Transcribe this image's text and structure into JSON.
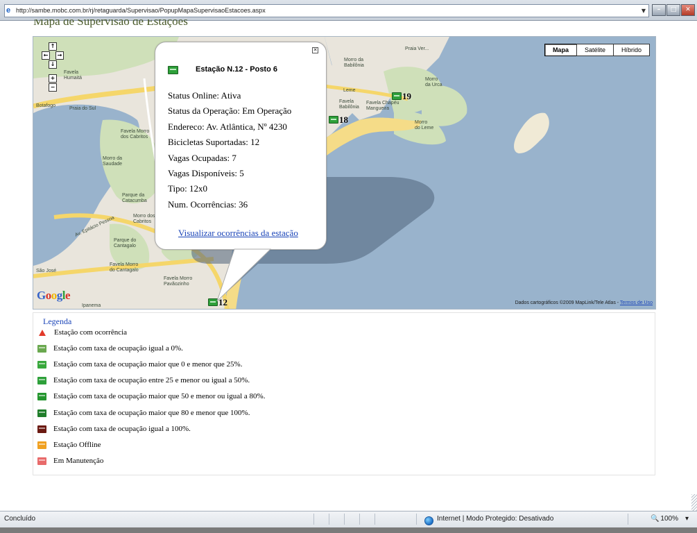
{
  "browser": {
    "url": "http://sambe.mobc.com.br/rj/retaguarda/Supervisao/PopupMapaSupervisaoEstacoes.aspx",
    "controls": {
      "minimize": "–",
      "maximize": "□",
      "close": "✕"
    }
  },
  "page": {
    "heading": "Mapa de Supervisão de Estações"
  },
  "map": {
    "types": [
      "Mapa",
      "Satélite",
      "Híbrido"
    ],
    "active_type": "Mapa",
    "labels": {
      "favela_humaita": "Favela\nHumaitá",
      "rio_sul": "Praia do Sul",
      "favela_morro": "Favela Morro\ndos Cabritos",
      "morro_saudade": "Morro da\nSaudade",
      "parque_catacumba": "Parque da\nCatacumba",
      "morro_cabritos": "Morro dos\nCabritos",
      "parque_cantagalo": "Parque do\nCantagalo",
      "favela_cantagalo": "Favela Morro\ndo Cantagalo",
      "favela_pavaozinho": "Favela Morro\nPavãozinho",
      "morro_babilonia": "Morro da\nBabilônia",
      "leme": "Leme",
      "favela_babilonia": "Favela\nBabilônia",
      "favela_chapeu": "Favela Chapéu\nMangueira",
      "morro_leme": "Morro\ndo Leme",
      "morro_urca": "Morro\nda Urca",
      "praia_vermelha": "Praia Ver...",
      "av_epitacio": "Av. Epitácio Pessoa",
      "botafogo": "Botafogo",
      "sao_jose": "São José",
      "ipanema": "Ipanema"
    },
    "markers": [
      {
        "num": "19",
        "color": "#2ea03a"
      },
      {
        "num": "18",
        "color": "#2ea03a"
      },
      {
        "num": "12",
        "color": "#2ea03a"
      }
    ],
    "logo": [
      "G",
      "o",
      "o",
      "g",
      "l",
      "e"
    ],
    "copyright": "Dados cartográficos ©2009 MapLink/Tele Atlas -",
    "terms_link": "Termos de Uso"
  },
  "info_window": {
    "title": "Estação N.12 - Posto 6",
    "close": "✕",
    "fields": [
      "Status Online: Ativa",
      "Status da Operação: Em Operação",
      "Endereco: Av. Atlântica, Nº 4230",
      "Bicicletas Suportadas: 12",
      "Vagas Ocupadas: 7",
      "Vagas Disponíveis: 5",
      "Tipo: 12x0",
      "Num. Ocorrências: 36"
    ],
    "link": "Visualizar ocorrências da estação"
  },
  "legend": {
    "title": "Legenda",
    "items": [
      {
        "label": "Estação com ocorrência",
        "icon": "warning-triangle-icon",
        "color": "#e23a2a"
      },
      {
        "label": "Estação com taxa de ocupação igual a 0%.",
        "icon": "station-0-icon",
        "color": "#6aa84f"
      },
      {
        "label": "Estação com taxa de ocupação maior que 0 e menor que 25%.",
        "icon": "station-25-icon",
        "color": "#38a83c"
      },
      {
        "label": "Estação com taxa de ocupação entre 25 e menor ou igual a 50%.",
        "icon": "station-50-icon",
        "color": "#2ea03a"
      },
      {
        "label": "Estação com taxa de ocupação maior que 50 e menor ou igual a 80%.",
        "icon": "station-80-icon",
        "color": "#25962f"
      },
      {
        "label": "Estação com taxa de ocupação maior que 80 e menor que 100%.",
        "icon": "station-99-icon",
        "color": "#1f7d2a"
      },
      {
        "label": "Estação com taxa de ocupação igual a 100%.",
        "icon": "station-100-icon",
        "color": "#6b1a12"
      },
      {
        "label": "Estação Offline",
        "icon": "station-offline-icon",
        "color": "#f0a020"
      },
      {
        "label": "Em Manutenção",
        "icon": "station-maintenance-icon",
        "color": "#e86a6a"
      }
    ]
  },
  "statusbar": {
    "left": "Concluído",
    "zone": "Internet | Modo Protegido: Desativado",
    "zoom": "100%",
    "zoom_arrow": "▾"
  }
}
